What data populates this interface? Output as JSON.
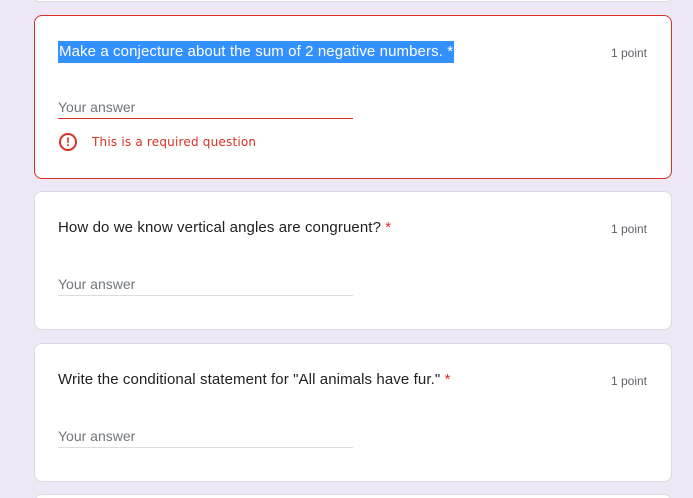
{
  "questions": [
    {
      "title": "Make a conjecture about the sum of 2 negative numbers.",
      "required_mark": "*",
      "points": "1 point",
      "placeholder": "Your answer",
      "error": "This is a required question",
      "error_icon": "!"
    },
    {
      "title": "How do we know vertical angles are congruent?",
      "required_mark": "*",
      "points": "1 point",
      "placeholder": "Your answer"
    },
    {
      "title": "Write the conditional statement for \"All animals have fur.\"",
      "required_mark": "*",
      "points": "1 point",
      "placeholder": "Your answer"
    }
  ],
  "colors": {
    "background": "#ede7f6",
    "error": "#d93025",
    "selection": "#3390ff"
  }
}
